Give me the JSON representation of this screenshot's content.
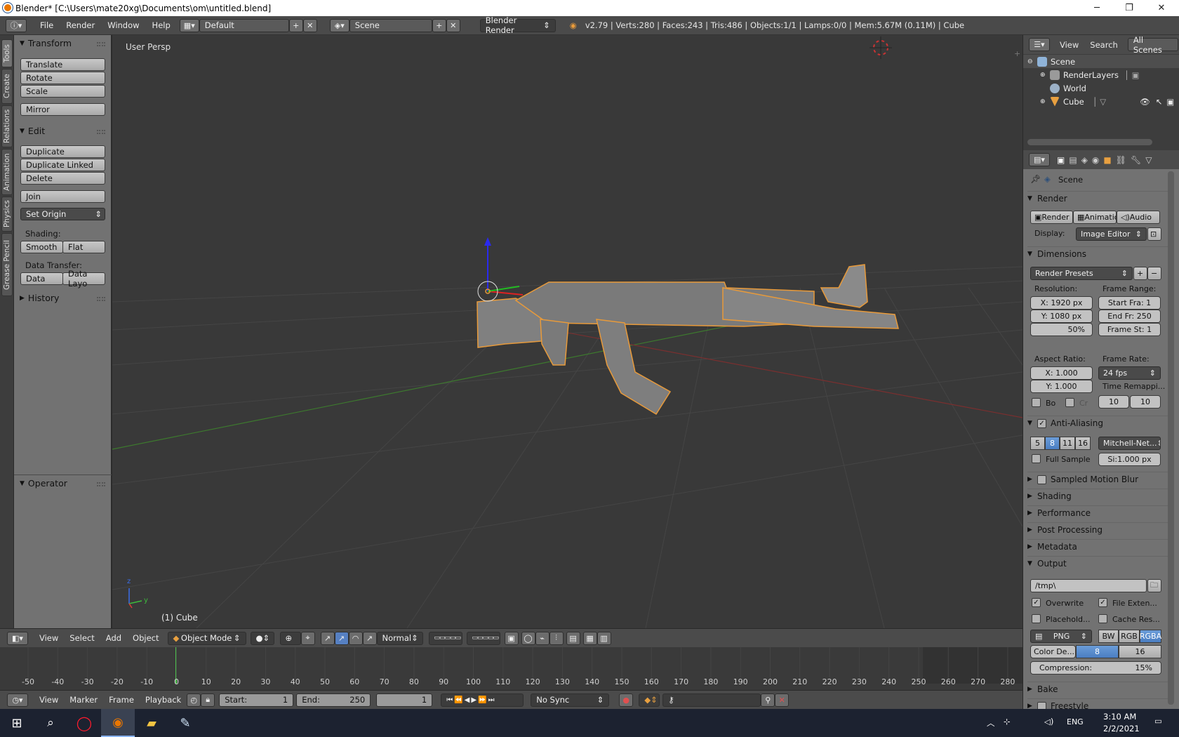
{
  "window": {
    "title": "Blender* [C:\\Users\\mate20xg\\Documents\\om\\untitled.blend]",
    "min": "─",
    "max": "❐",
    "close": "✕"
  },
  "infobar": {
    "menus": [
      "File",
      "Render",
      "Window",
      "Help"
    ],
    "screen_layout": "Default",
    "scene": "Scene",
    "engine": "Blender Render",
    "stats": "v2.79 | Verts:280 | Faces:243 | Tris:486 | Objects:1/1 | Lamps:0/0 | Mem:5.67M (0.11M) | Cube"
  },
  "tool_tabs": [
    "Tools",
    "Create",
    "Relations",
    "Animation",
    "Physics",
    "Grease Pencil"
  ],
  "toolshelf": {
    "transform_header": "Transform",
    "transform_buttons": [
      "Translate",
      "Rotate",
      "Scale"
    ],
    "mirror": "Mirror",
    "edit_header": "Edit",
    "edit_buttons": [
      "Duplicate",
      "Duplicate Linked",
      "Delete"
    ],
    "join": "Join",
    "set_origin": "Set Origin",
    "shading_label": "Shading:",
    "smooth": "Smooth",
    "flat": "Flat",
    "data_transfer_label": "Data Transfer:",
    "data": "Data",
    "data_layout": "Data Layo",
    "history_header": "History",
    "operator_header": "Operator"
  },
  "viewport": {
    "title": "User Persp",
    "object_label": "(1) Cube",
    "axis_z": "z",
    "axis_y": "y"
  },
  "viewport_header": {
    "menus": [
      "View",
      "Select",
      "Add",
      "Object"
    ],
    "mode": "Object Mode",
    "pivot": "Normal"
  },
  "timeline": {
    "ticks": [
      "-50",
      "-40",
      "-30",
      "-20",
      "-10",
      "0",
      "10",
      "20",
      "30",
      "40",
      "50",
      "60",
      "70",
      "80",
      "90",
      "100",
      "110",
      "120",
      "130",
      "140",
      "150",
      "160",
      "170",
      "180",
      "190",
      "200",
      "210",
      "220",
      "230",
      "240",
      "250",
      "260",
      "270",
      "280"
    ],
    "current_frame_marker": "0",
    "menus": [
      "View",
      "Marker",
      "Frame",
      "Playback"
    ],
    "start_label": "Start:",
    "start": "1",
    "end_label": "End:",
    "end": "250",
    "current": "1",
    "sync": "No Sync"
  },
  "outliner": {
    "menus": [
      "View",
      "Search"
    ],
    "filter": "All Scenes",
    "items": [
      "Scene",
      "RenderLayers",
      "World",
      "Cube"
    ]
  },
  "properties": {
    "context": "Scene",
    "render_header": "Render",
    "render_btn": "Render",
    "animation_btn": "Animatio",
    "audio_btn": "Audio",
    "display_label": "Display:",
    "display_value": "Image Editor",
    "dimensions_header": "Dimensions",
    "render_presets": "Render Presets",
    "resolution_label": "Resolution:",
    "res_x": "X: 1920 px",
    "res_y": "Y: 1080 px",
    "res_pct": "50%",
    "frame_range_label": "Frame Range:",
    "start_frame": "Start Fra: 1",
    "end_frame": "End Fr: 250",
    "frame_step": "Frame St: 1",
    "aspect_label": "Aspect Ratio:",
    "aspect_x": "X:     1.000",
    "aspect_y": "Y:     1.000",
    "frame_rate_label": "Frame Rate:",
    "frame_rate": "24 fps",
    "time_remap_label": "Time Remappi...",
    "remap_old": "10",
    "remap_new": "10",
    "border": "Bo",
    "crop": "Cr",
    "aa_header": "Anti-Aliasing",
    "aa_samples": [
      "5",
      "8",
      "11",
      "16"
    ],
    "aa_filter": "Mitchell-Net...",
    "full_sample": "Full Sample",
    "filter_size": "Si:1.000 px",
    "collapsed": [
      "Sampled Motion Blur",
      "Shading",
      "Performance",
      "Post Processing",
      "Metadata"
    ],
    "output_header": "Output",
    "output_path": "/tmp\\",
    "overwrite": "Overwrite",
    "file_ext": "File Exten...",
    "placeholders": "Placehold...",
    "cache_result": "Cache Res...",
    "format": "PNG",
    "color_modes": [
      "BW",
      "RGB",
      "RGBA"
    ],
    "color_depth_label": "Color De...",
    "depths": [
      "8",
      "16"
    ],
    "compression": "Compression:",
    "compression_value": "15%",
    "bake_header": "Bake",
    "freestyle_header": "Freestyle"
  },
  "taskbar": {
    "time": "3:10 AM",
    "date": "2/2/2021",
    "lang": "ENG"
  }
}
